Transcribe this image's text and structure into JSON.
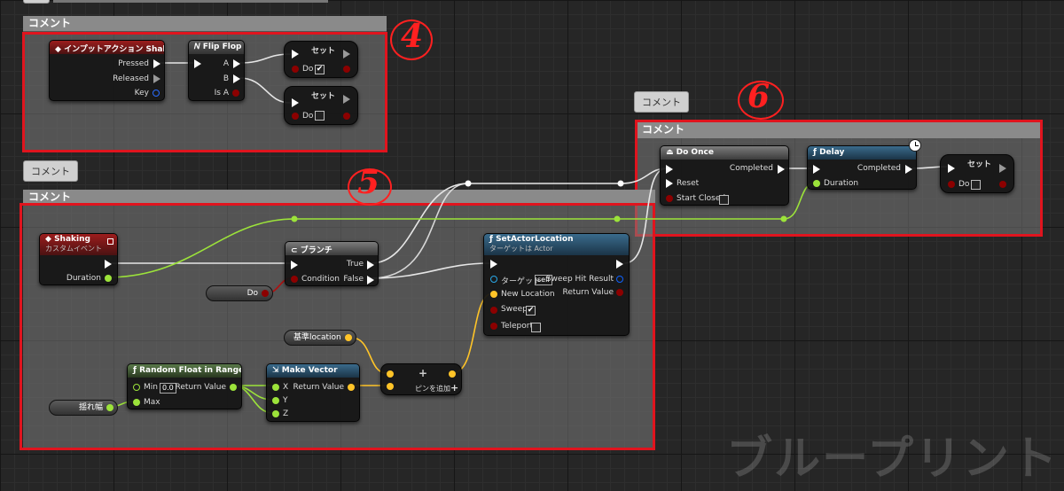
{
  "comment_label": "コメント",
  "watermark": "ブループリント",
  "annotations": {
    "a4": "4",
    "a5": "5",
    "a6": "6"
  },
  "colors": {
    "exec": "#ffffff",
    "bool": "#8c0000",
    "float": "#9ce33a",
    "vector": "#ffc428",
    "struct": "#0f62ff",
    "object": "#2aa8e8",
    "frame": "#e0141e"
  },
  "nodes": {
    "input_action": {
      "title": "インプットアクション Shake",
      "pressed": "Pressed",
      "released": "Released",
      "key": "Key"
    },
    "flipflop": {
      "title": "Flip Flop",
      "a": "A",
      "b": "B",
      "isa": "Is A"
    },
    "set1": {
      "title": "セット",
      "do": "Do",
      "check": "✔"
    },
    "set2": {
      "title": "セット",
      "do": "Do",
      "check": ""
    },
    "doonce": {
      "title": "Do Once",
      "completed": "Completed",
      "reset": "Reset",
      "start_closed": "Start Closed"
    },
    "delay": {
      "title": "Delay",
      "completed": "Completed",
      "duration": "Duration"
    },
    "set3": {
      "title": "セット",
      "do": "Do",
      "check": ""
    },
    "shaking": {
      "title": "Shaking",
      "subtitle": "カスタムイベント",
      "duration": "Duration"
    },
    "branch": {
      "title": "ブランチ",
      "condition": "Condition",
      "true": "True",
      "false": "False"
    },
    "do_var": {
      "label": "Do"
    },
    "setactorlocation": {
      "title": "SetActorLocation",
      "subtitle": "ターゲットは Actor",
      "target": "ターゲット",
      "self": "self",
      "sweep_hit": "Sweep Hit Result",
      "new_location": "New Location",
      "return_value": "Return Value",
      "sweep": "Sweep",
      "sweep_check": "✔",
      "teleport": "Teleport",
      "teleport_check": ""
    },
    "base_location": {
      "label": "基準location"
    },
    "random_float": {
      "title": "Random Float in Range",
      "min": "Min",
      "min_value": "0.0",
      "max": "Max",
      "return_value": "Return Value"
    },
    "yure_var": {
      "label": "揺れ幅"
    },
    "make_vector": {
      "title": "Make Vector",
      "x": "X",
      "y": "Y",
      "z": "Z",
      "return_value": "Return Value"
    },
    "add_node": {
      "plus": "+",
      "add_pin": "ピンを追加",
      "add_pin_plus": "+"
    }
  }
}
